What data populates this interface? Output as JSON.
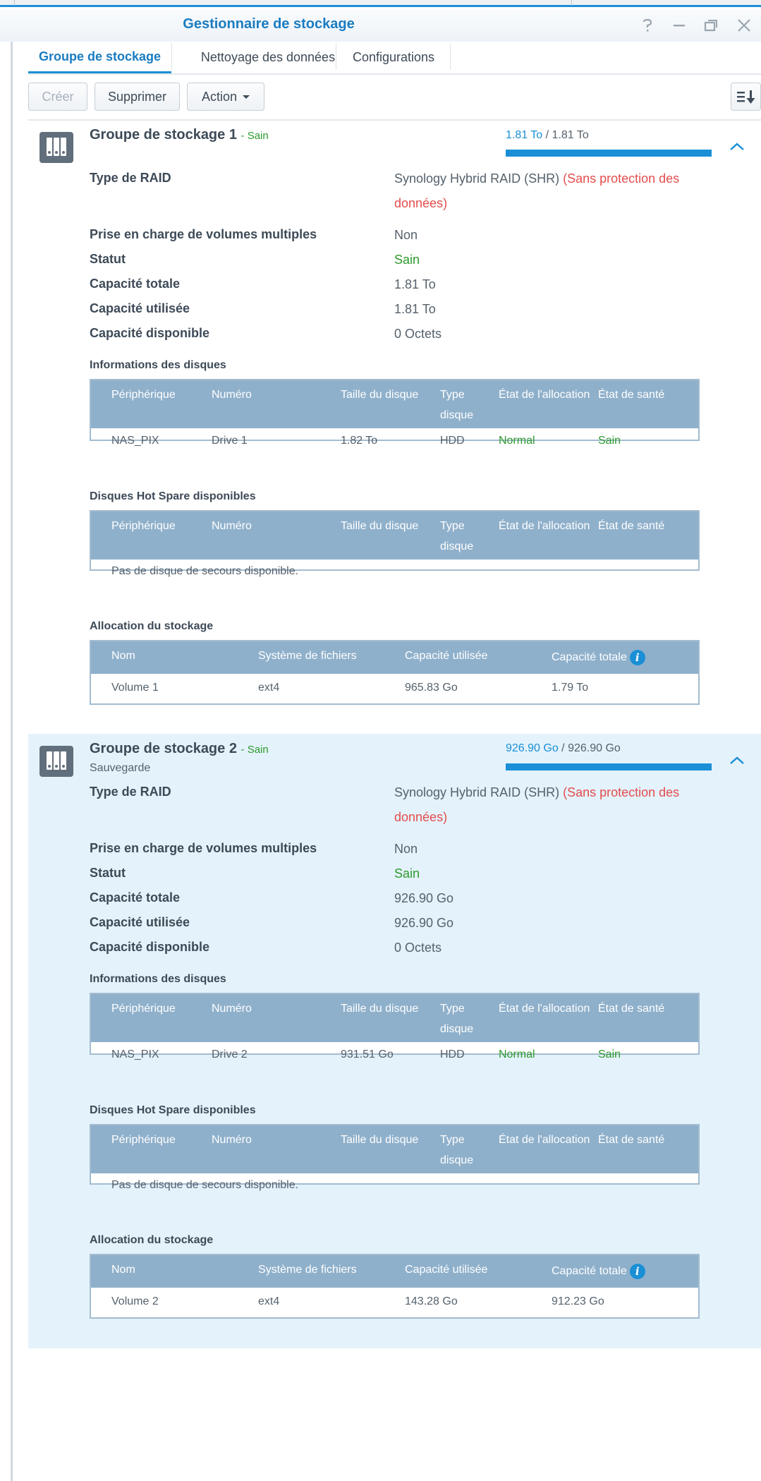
{
  "window": {
    "title": "Gestionnaire de stockage"
  },
  "tabs": [
    {
      "label": "Groupe de stockage"
    },
    {
      "label": "Nettoyage des données"
    },
    {
      "label": "Configurations"
    }
  ],
  "toolbar": {
    "create_label": "Créer",
    "delete_label": "Supprimer",
    "action_label": "Action"
  },
  "labels": {
    "raid_type": "Type de RAID",
    "multi_volume": "Prise en charge de volumes multiples",
    "status": "Statut",
    "total_capacity": "Capacité totale",
    "used_capacity": "Capacité utilisée",
    "available_capacity": "Capacité disponible",
    "disk_info": "Informations des disques",
    "hot_spare": "Disques Hot Spare disponibles",
    "storage_allocation": "Allocation du stockage"
  },
  "disk_columns": [
    "Périphérique",
    "Numéro",
    "Taille du disque",
    "Type disque",
    "État de l'allocation",
    "État de santé"
  ],
  "alloc_columns": [
    "Nom",
    "Système de fichiers",
    "Capacité utilisée",
    "Capacité totale"
  ],
  "no_hot_spare": "Pas de disque de secours disponible.",
  "groups": [
    {
      "name": "Groupe de stockage 1",
      "status_suffix": "- Sain",
      "subtitle": "",
      "cap_used": "1.81 To",
      "cap_sep": " / ",
      "cap_total": "1.81 To",
      "raid_type": "Synology Hybrid RAID (SHR)",
      "raid_warning": "(Sans protection des données)",
      "multi_volume": "Non",
      "status": "Sain",
      "total_capacity": "1.81 To",
      "used_capacity": "1.81 To",
      "available_capacity": "0 Octets",
      "disks": [
        {
          "device": "NAS_PIX",
          "number": "Drive 1",
          "size": "1.82 To",
          "type": "HDD",
          "allocation": "Normal",
          "health": "Sain"
        }
      ],
      "volumes": [
        {
          "name": "Volume 1",
          "fs": "ext4",
          "used": "965.83 Go",
          "total": "1.79 To"
        }
      ]
    },
    {
      "name": "Groupe de stockage 2",
      "status_suffix": "- Sain",
      "subtitle": "Sauvegarde",
      "cap_used": "926.90 Go",
      "cap_sep": " / ",
      "cap_total": "926.90 Go",
      "raid_type": "Synology Hybrid RAID (SHR)",
      "raid_warning": "(Sans protection des données)",
      "multi_volume": "Non",
      "status": "Sain",
      "total_capacity": "926.90 Go",
      "used_capacity": "926.90 Go",
      "available_capacity": "0 Octets",
      "disks": [
        {
          "device": "NAS_PIX",
          "number": "Drive 2",
          "size": "931.51 Go",
          "type": "HDD",
          "allocation": "Normal",
          "health": "Sain"
        }
      ],
      "volumes": [
        {
          "name": "Volume 2",
          "fs": "ext4",
          "used": "143.28 Go",
          "total": "912.23 Go"
        }
      ]
    }
  ],
  "colors": {
    "accent": "#1a8fd6",
    "healthy": "#2d9a2d",
    "warning": "#e34d4d",
    "table_header": "#8fb0cb",
    "group_highlight": "#e4f2fb"
  },
  "icons": [
    "help-icon",
    "minimize-icon",
    "restore-icon",
    "close-icon",
    "storage-pool-icon",
    "chevron-up-icon",
    "info-icon",
    "sort-icon"
  ]
}
